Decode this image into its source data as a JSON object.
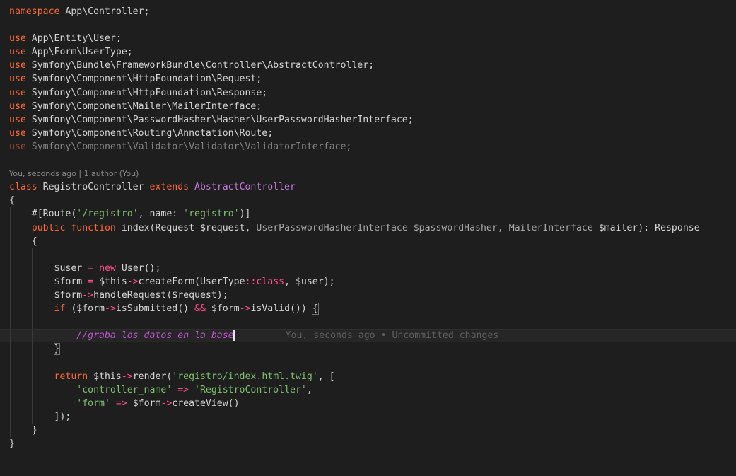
{
  "code": {
    "namespace_kw": "namespace",
    "namespace_name": " App\\Controller;",
    "uses": [
      "App\\Entity\\User;",
      "App\\Form\\UserType;",
      "Symfony\\Bundle\\FrameworkBundle\\Controller\\AbstractController;",
      "Symfony\\Component\\HttpFoundation\\Request;",
      "Symfony\\Component\\HttpFoundation\\Response;",
      "Symfony\\Component\\Mailer\\MailerInterface;",
      "Symfony\\Component\\PasswordHasher\\Hasher\\UserPasswordHasherInterface;",
      "Symfony\\Component\\Routing\\Annotation\\Route;",
      "Symfony\\Component\\Validator\\Validator\\ValidatorInterface;"
    ],
    "use_kw": "use",
    "codelens": "You, seconds ago | 1 author (You)",
    "class_kw": "class",
    "class_name": " RegistroController ",
    "extends_kw": "extends",
    "parent_class": " AbstractController",
    "open_brace": "{",
    "close_brace": "}",
    "attr_prefix": "#[Route(",
    "route_path": "'/registro'",
    "attr_mid": ", name: ",
    "route_name": "'registro'",
    "attr_suffix": ")]",
    "public_kw": "public",
    "function_kw": "function",
    "method_sig_1": " index(Request $request, ",
    "method_param_type": "UserPasswordHasherInterface",
    "method_sig_2": " $passwordHasher, ",
    "method_param_type2": "MailerInterface",
    "method_sig_3": " $mailer): Response",
    "l_user_1": "$user ",
    "l_user_eq": "=",
    "l_user_new": " new ",
    "l_user_2": "User();",
    "l_form_1": "$form ",
    "l_form_eq": "=",
    "l_form_2": " $this",
    "l_form_arrow": "->",
    "l_form_3": "createForm(UserType",
    "l_form_dc": "::",
    "l_form_class": "class",
    "l_form_4": ", $user);",
    "l_handle_1": "$form",
    "l_handle_arrow": "->",
    "l_handle_2": "handleRequest($request);",
    "l_if_kw": "if",
    "l_if_1": " ($form",
    "l_if_arrow1": "->",
    "l_if_2": "isSubmitted() ",
    "l_if_and": "&&",
    "l_if_3": " $form",
    "l_if_arrow2": "->",
    "l_if_4": "isValid()) ",
    "l_if_brace": "{",
    "comment": "//graba los datos en la base",
    "blame": "You, seconds ago • Uncommitted changes",
    "l_close_if": "}",
    "return_kw": "return",
    "l_ret_1": " $this",
    "l_ret_arrow": "->",
    "l_ret_2": "render(",
    "l_ret_tpl": "'registro/index.html.twig'",
    "l_ret_3": ", [",
    "arr_key1": "'controller_name'",
    "arr_op1": " => ",
    "arr_val1": "'RegistroController'",
    "arr_comma1": ",",
    "arr_key2": "'form'",
    "arr_op2": " => ",
    "arr_val2_1": "$form",
    "arr_val2_arrow": "->",
    "arr_val2_2": "createView()",
    "l_ret_close": "]);",
    "method_close": "}",
    "class_close": "}"
  }
}
